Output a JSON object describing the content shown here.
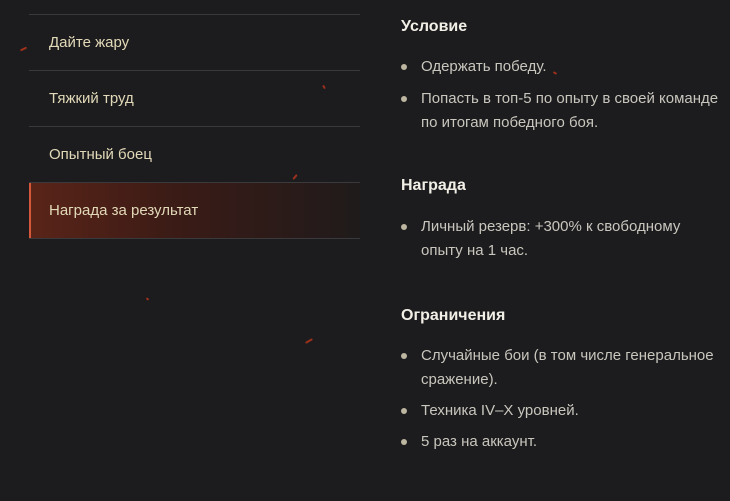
{
  "menu": {
    "items": [
      {
        "label": "Дайте жару",
        "active": false
      },
      {
        "label": "Тяжкий труд",
        "active": false
      },
      {
        "label": "Опытный боец",
        "active": false
      },
      {
        "label": "Награда за результат",
        "active": true
      }
    ]
  },
  "content": {
    "condition": {
      "title": "Условие",
      "items": [
        "Одержать победу.",
        "Попасть в топ-5 по опыту в своей команде по итогам победного боя."
      ]
    },
    "reward": {
      "title": "Награда",
      "items": [
        "Личный резерв: +300% к свободному опыту на 1 час."
      ]
    },
    "restrictions": {
      "title": "Ограничения",
      "items": [
        "Случайные бои (в том числе генеральное сражение).",
        "Техника IV–X уровней.",
        "5 раз на аккаунт."
      ]
    }
  },
  "colors": {
    "background": "#1c1c1e",
    "accent": "#d4573a",
    "menu_text": "#e2d9b8",
    "spark": "#b3341b"
  }
}
